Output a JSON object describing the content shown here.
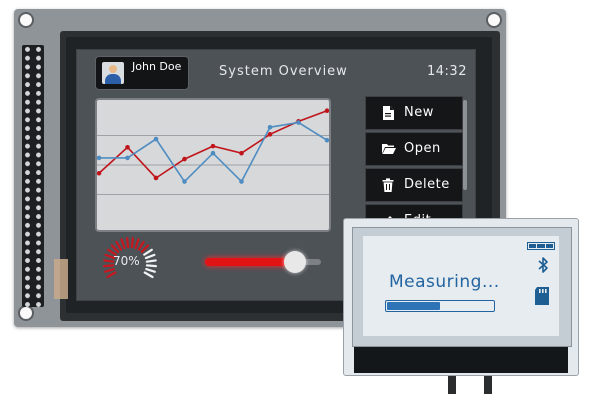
{
  "header": {
    "user_name": "John Doe",
    "title": "System Overview",
    "clock": "14:32"
  },
  "menu": {
    "items": [
      {
        "label": "New",
        "icon": "new-file-icon"
      },
      {
        "label": "Open",
        "icon": "folder-open-icon"
      },
      {
        "label": "Delete",
        "icon": "trash-icon"
      },
      {
        "label": "Edit",
        "icon": "pencil-icon"
      }
    ]
  },
  "gauge": {
    "label": "70%",
    "value": 0.7,
    "color": "#c8161e"
  },
  "slider": {
    "value": 0.78,
    "color": "#e01414"
  },
  "chart_data": {
    "type": "line",
    "x": [
      0,
      1,
      2,
      3,
      4,
      5,
      6,
      7,
      8
    ],
    "ylim": [
      0,
      100
    ],
    "grid": true,
    "series": [
      {
        "color": "#c0151b",
        "values": [
          43,
          65,
          39,
          55,
          66,
          60,
          76,
          87,
          96
        ]
      },
      {
        "color": "#4e8cc1",
        "values": [
          56,
          56,
          72,
          36,
          60,
          36,
          82,
          86,
          71
        ]
      }
    ]
  },
  "lcd": {
    "status_text": "Measuring...",
    "progress": 0.5,
    "battery_icon": "battery-icon",
    "bluetooth_icon": "bluetooth-icon",
    "sd_icon": "sd-card-icon",
    "text_color": "#2264a0"
  }
}
